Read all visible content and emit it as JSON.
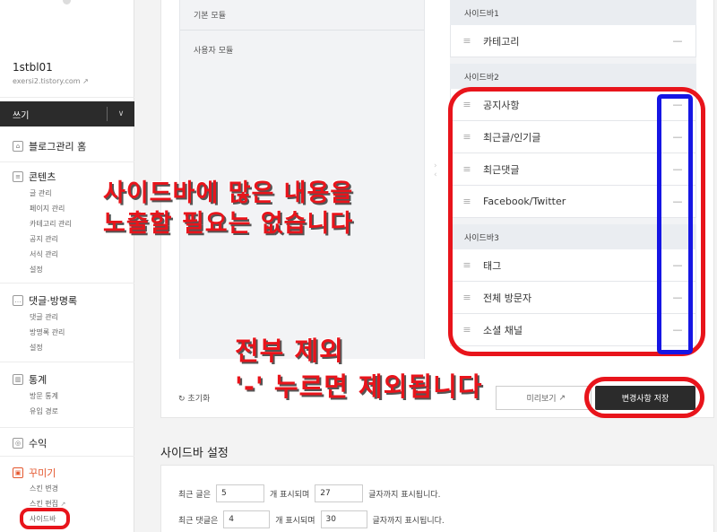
{
  "sidebar": {
    "blog_id": "1stbl01",
    "blog_url": "exersi2.tistory.com",
    "write_label": "쓰기",
    "home_label": "블로그관리 홈",
    "content": {
      "label": "콘텐츠",
      "items": [
        "글 관리",
        "페이지 관리",
        "카테고리 관리",
        "공지 관리",
        "서식 관리",
        "설정"
      ]
    },
    "comments": {
      "label": "댓글·방명록",
      "items": [
        "댓글 관리",
        "방명록 관리",
        "설정"
      ]
    },
    "stats": {
      "label": "통계",
      "items": [
        "방문 통계",
        "유입 경로"
      ]
    },
    "revenue": {
      "label": "수익"
    },
    "decorate": {
      "label": "꾸미기",
      "items": [
        "스킨 변경",
        "스킨 편집",
        "사이드바"
      ]
    }
  },
  "modules": {
    "basic": "기본 모듈",
    "user": "사용자 모듈"
  },
  "sidebars": [
    {
      "title": "사이드바1",
      "items": [
        "카테고리"
      ]
    },
    {
      "title": "사이드바2",
      "items": [
        "공지사항",
        "최근글/인기글",
        "최근댓글",
        "Facebook/Twitter"
      ]
    },
    {
      "title": "사이드바3",
      "items": [
        "태그",
        "전체 방문자",
        "소셜 채널"
      ]
    }
  ],
  "remove_glyph": "—",
  "grip_glyph": "≡",
  "actions": {
    "reset": "초기화",
    "preview": "미리보기",
    "save": "변경사항 저장"
  },
  "settings": {
    "title": "사이드바 설정",
    "row1": {
      "prefix": "최근 글은",
      "count": "5",
      "mid": "개 표시되며",
      "chars": "27",
      "suffix": "글자까지 표시됩니다."
    },
    "row2": {
      "prefix": "최근 댓글은",
      "count": "4",
      "mid": "개 표시되며",
      "chars": "30",
      "suffix": "글자까지 표시됩니다."
    }
  },
  "annotations": {
    "note1_line1": "사이드바에 많은 내용을",
    "note1_line2": "노출할 필요는 없습니다",
    "note2_line1": "전부 제외",
    "note2_line2": "'-' 누르면 제외됩니다"
  },
  "colors": {
    "annotation_red": "#e8141b",
    "annotation_blue": "#1616e4",
    "accent": "#e4572e",
    "dark_button": "#2b2b2b"
  }
}
